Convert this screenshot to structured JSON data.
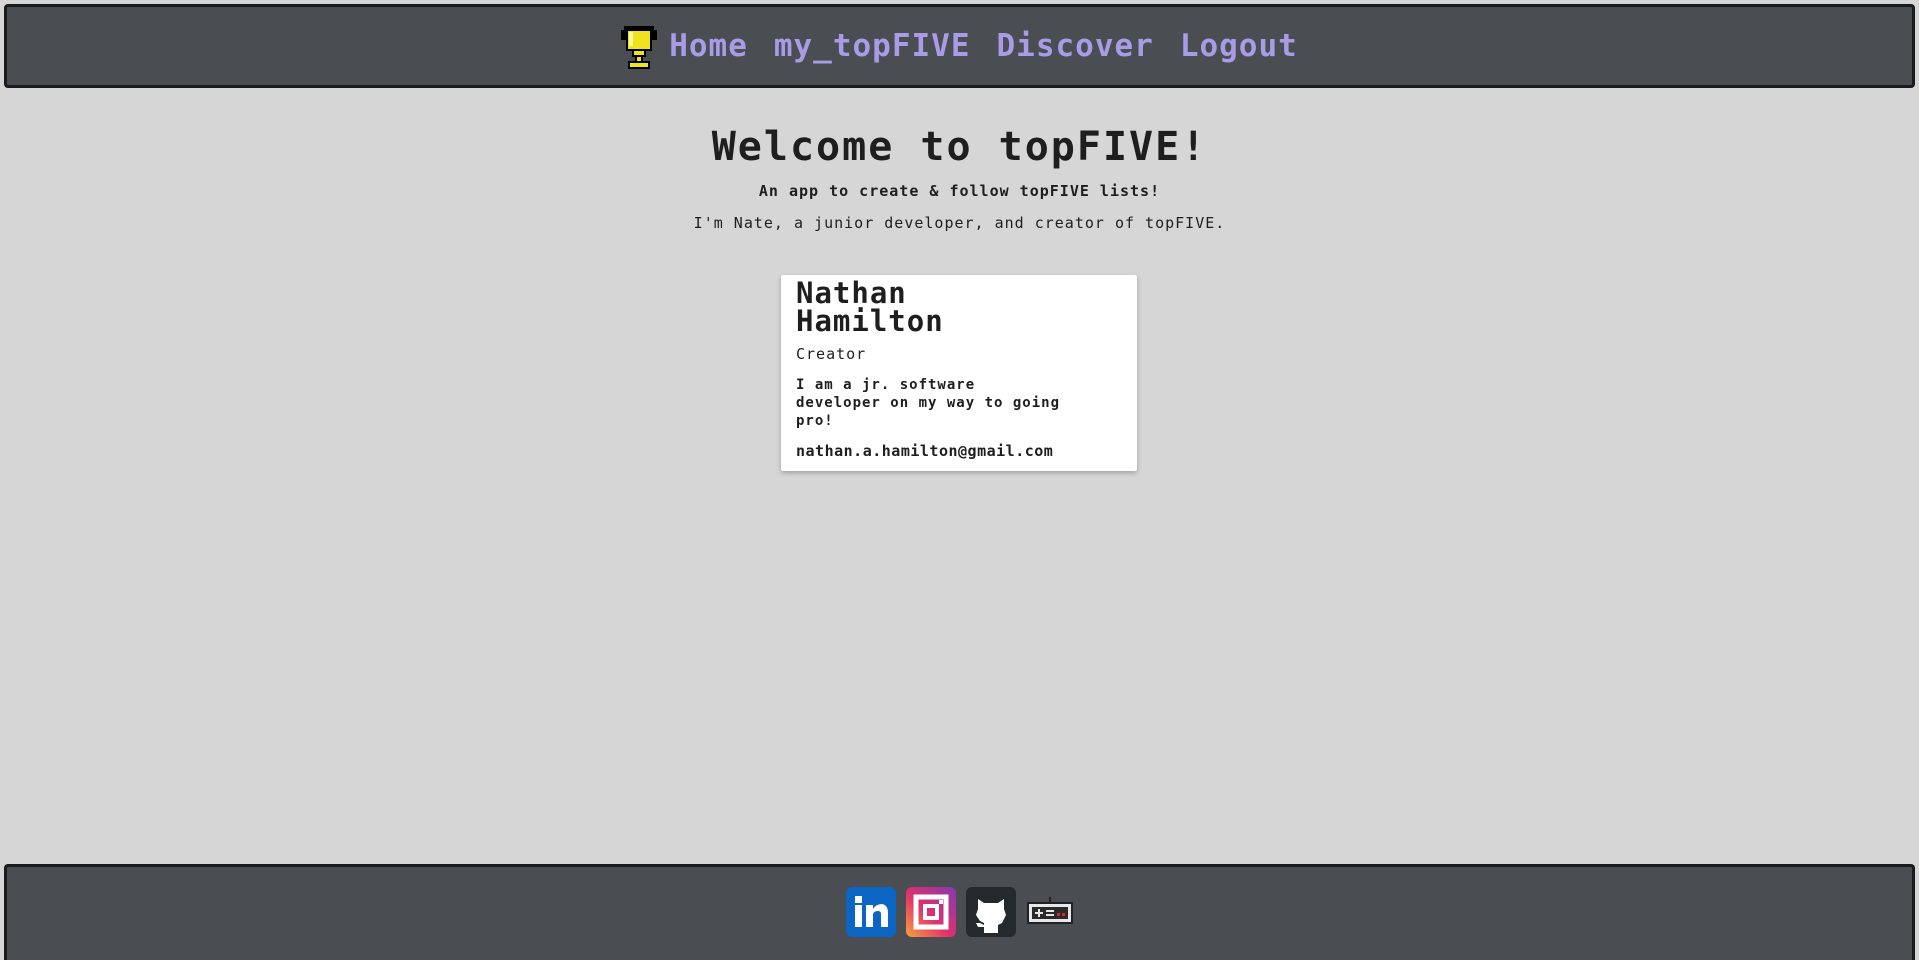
{
  "nav": {
    "items": [
      "Home",
      "my_topFIVE",
      "Discover",
      "Logout"
    ]
  },
  "hero": {
    "title": "Welcome to topFIVE!",
    "tagline": "An app to create & follow topFIVE lists!",
    "intro": "I'm Nate, a junior developer, and creator of topFIVE."
  },
  "card": {
    "name": "Nathan Hamilton",
    "role": "Creator",
    "bio": "I am a jr. software developer on my way to going pro!",
    "email": "nathan.a.hamilton@gmail.com"
  },
  "footer": {
    "socials": [
      "linkedin-icon",
      "instagram-icon",
      "github-icon",
      "gamepad-icon"
    ]
  },
  "colors": {
    "bar": "#4a4e53",
    "nav_link": "#a99be6",
    "page_bg": "#d6d6d6",
    "linkedin": "#0a66c2"
  }
}
